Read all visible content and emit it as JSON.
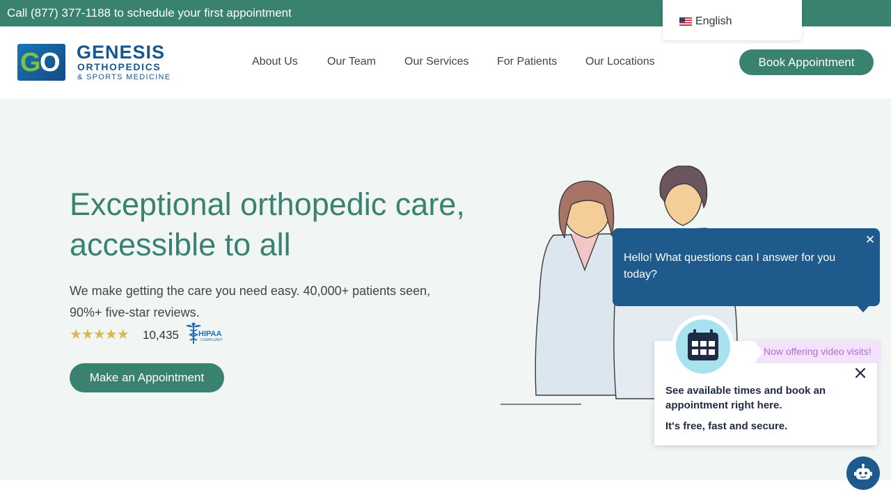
{
  "topbar": {
    "text": "Call (877) 377-1188 to schedule your first appointment"
  },
  "language": {
    "label": "English",
    "flag_icon": "us-flag-icon"
  },
  "logo": {
    "mark_g": "G",
    "mark_o": "O",
    "name": "GENESIS",
    "sub1": "ORTHOPEDICS",
    "sub2": "& SPORTS MEDICINE"
  },
  "nav": {
    "items": [
      {
        "label": "About Us"
      },
      {
        "label": "Our Team"
      },
      {
        "label": "Our Services"
      },
      {
        "label": "For Patients"
      },
      {
        "label": "Our Locations"
      }
    ],
    "book_label": "Book Appointment"
  },
  "hero": {
    "title": "Exceptional orthopedic care, accessible to all",
    "subtitle": "We make getting the care you need easy. 40,000+ patients seen, 90%+ five-star reviews.",
    "stars": "★★★★★",
    "rating_stars": 5,
    "review_count": "10,435",
    "hipaa_label": "HIPAA",
    "hipaa_sub": "COMPLIANT",
    "cta_label": "Make an Appointment"
  },
  "chat": {
    "message": "Hello! What questions can I answer for you today?",
    "close_glyph": "✕"
  },
  "appointment_widget": {
    "video_badge": "Now offering video visits!",
    "line1": "See available times and book an appointment right here.",
    "line2": "It's free, fast and secure."
  },
  "colors": {
    "brand_green": "#3a8270",
    "brand_blue": "#17568f",
    "chat_blue": "#1e5a8c",
    "star_gold": "#e0b64c",
    "hero_bg": "#f1f5f3"
  }
}
